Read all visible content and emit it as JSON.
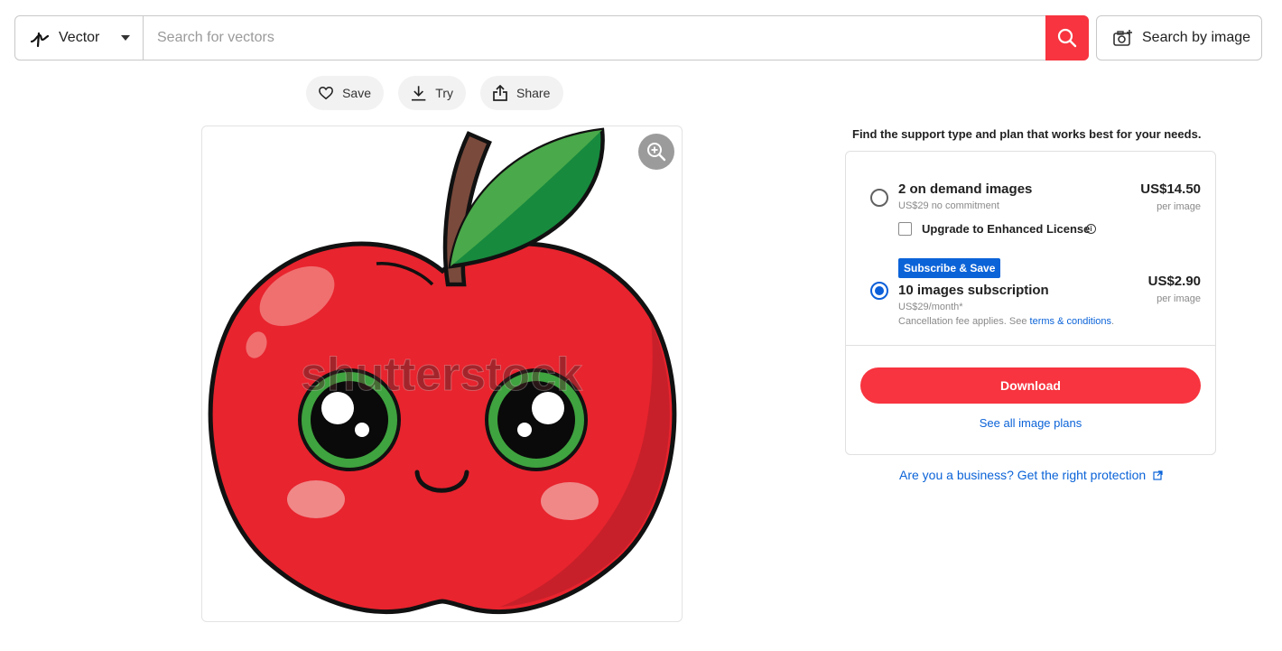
{
  "search": {
    "type_label": "Vector",
    "placeholder": "Search for vectors",
    "value": "",
    "search_by_image_label": "Search by image"
  },
  "actions": {
    "save_label": "Save",
    "try_label": "Try",
    "share_label": "Share"
  },
  "image": {
    "watermark": "shutterstock"
  },
  "plans": {
    "heading": "Find the support type and plan that works best for your needs.",
    "on_demand": {
      "title": "2 on demand images",
      "subtitle": "US$29 no commitment",
      "price": "US$14.50",
      "per": "per image",
      "selected": false,
      "upgrade_label": "Upgrade to Enhanced License",
      "upgrade_checked": false
    },
    "subscription": {
      "badge": "Subscribe & Save",
      "title": "10 images subscription",
      "subtitle": "US$29/month*",
      "fee_note": "Cancellation fee applies. See ",
      "terms_link": "terms & conditions",
      "fee_note_end": ".",
      "price": "US$2.90",
      "per": "per image",
      "selected": true
    },
    "download_label": "Download",
    "see_all_label": "See all image plans"
  },
  "business_link": "Are you a business? Get the right protection",
  "colors": {
    "brand_red": "#f7343f",
    "link_blue": "#0b63d8"
  }
}
